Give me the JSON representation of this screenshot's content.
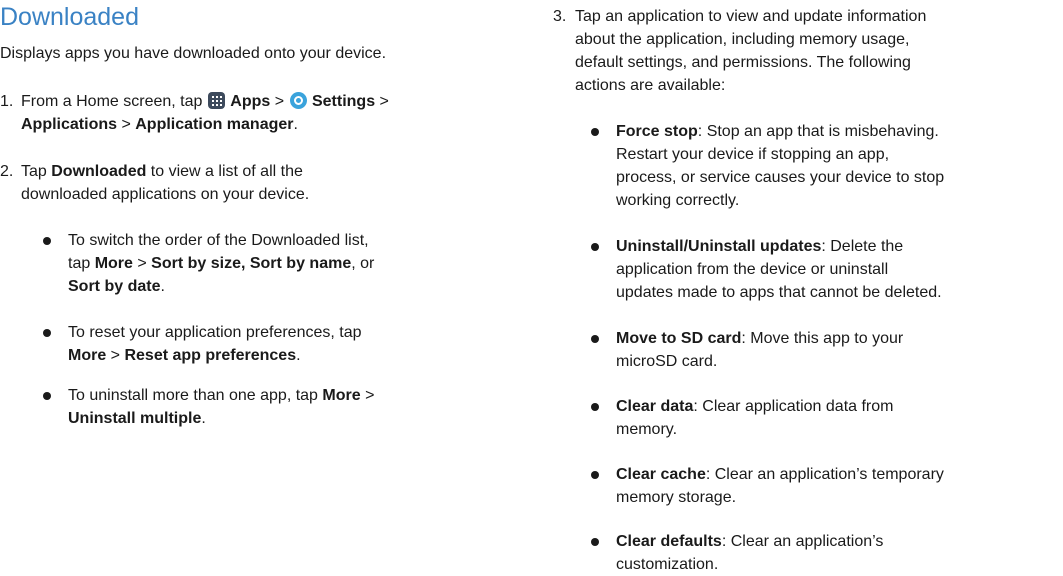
{
  "section": {
    "title": "Downloaded",
    "intro": "Displays apps you have downloaded onto your device."
  },
  "steps": [
    {
      "num": "1.",
      "line1_pre": "From a Home screen, tap ",
      "apps": "Apps",
      "sep1": " > ",
      "settings": "Settings",
      "sep2": " >",
      "applications": "Applications",
      "sep3": " > ",
      "app_manager": "Application manager",
      "end": ".",
      "apps_icon": "apps-grid-icon",
      "settings_icon": "settings-gear-icon"
    },
    {
      "num": "2.",
      "pre": "Tap ",
      "bold": "Downloaded",
      "post_line1": " to view a list of all the",
      "line2": "downloaded applications on your device."
    },
    {
      "num": "3.",
      "lines": [
        "Tap an application to view and update information",
        "about the application, including memory usage,",
        "default settings, and permissions. The following",
        "actions are available:"
      ]
    }
  ],
  "step2_bullets": [
    {
      "l1": "To switch the order of the Downloaded list,",
      "l2_pre": "tap ",
      "l2_b1": "More",
      "l2_sep": " > ",
      "l2_b2": "Sort by size, Sort by name",
      "l2_post": ", or",
      "l3_b": "Sort by date",
      "l3_post": "."
    },
    {
      "l1": "To reset your application preferences, tap",
      "l2_b1": "More",
      "l2_sep": " > ",
      "l2_b2": "Reset app preferences",
      "l2_post": "."
    },
    {
      "l1_pre": "To uninstall more than one app, tap ",
      "l1_b": "More",
      "l1_post": " >",
      "l2_b": "Uninstall multiple",
      "l2_post": "."
    }
  ],
  "actions": [
    {
      "name": "Force stop",
      "lines": [
        ": Stop an app that is misbehaving.",
        "Restart your device if stopping an app,",
        "process, or service causes your device to stop",
        "working correctly."
      ]
    },
    {
      "name": "Uninstall/Uninstall updates",
      "lines": [
        ": Delete the",
        "application from the device or uninstall",
        "updates made to apps that cannot be deleted."
      ]
    },
    {
      "name": "Move to SD card",
      "lines": [
        ": Move this app to your",
        "microSD card."
      ]
    },
    {
      "name": "Clear data",
      "lines": [
        ": Clear application data from",
        "memory."
      ]
    },
    {
      "name": "Clear cache",
      "lines": [
        ": Clear an application’s temporary",
        "memory storage."
      ]
    },
    {
      "name": "Clear defaults",
      "lines": [
        ": Clear an application’s",
        "customization."
      ]
    }
  ]
}
